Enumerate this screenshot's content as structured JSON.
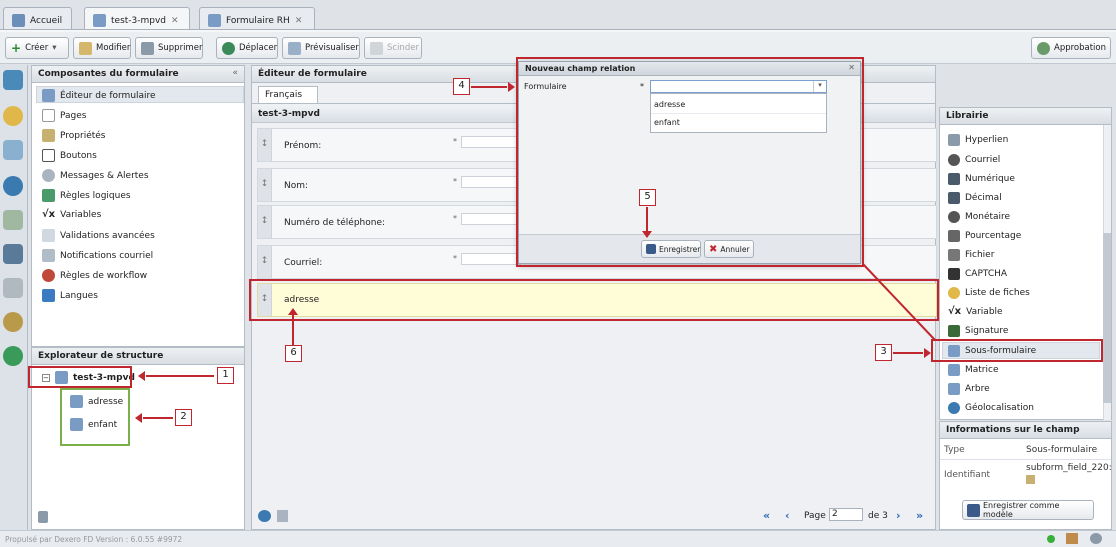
{
  "tabs": [
    "Accueil",
    "test-3-mpvd",
    "Formulaire RH"
  ],
  "toolbar": {
    "create": "Créer",
    "modify": "Modifier",
    "delete": "Supprimer",
    "move": "Déplacer",
    "preview": "Prévisualiser",
    "split": "Scinder",
    "approval": "Approbation"
  },
  "left": {
    "title": "Composantes du formulaire",
    "items": [
      "Éditeur de formulaire",
      "Pages",
      "Propriétés",
      "Boutons",
      "Messages & Alertes",
      "Règles logiques",
      "Variables",
      "Validations avancées",
      "Notifications courriel",
      "Règles de workflow",
      "Langues"
    ]
  },
  "explorer": {
    "title": "Explorateur de structure",
    "root": "test-3-mpvd",
    "children": [
      "adresse",
      "enfant"
    ]
  },
  "editor": {
    "title": "Éditeur de formulaire",
    "lang_tab": "Français",
    "form_name": "test-3-mpvd",
    "fields": [
      "Prénom:",
      "Nom:",
      "Numéro de téléphone:",
      "Courriel:"
    ],
    "required": "*",
    "new_field": "adresse"
  },
  "pager": {
    "page_label": "Page",
    "page_value": "2",
    "of_label": "de 3"
  },
  "dialog": {
    "title": "Nouveau champ relation",
    "label": "Formulaire",
    "required": "*",
    "options": [
      "adresse",
      "enfant"
    ],
    "save": "Enregistrer",
    "cancel": "Annuler"
  },
  "library": {
    "title": "Librairie",
    "items": [
      "Hyperlien",
      "Courriel",
      "Numérique",
      "Décimal",
      "Monétaire",
      "Pourcentage",
      "Fichier",
      "CAPTCHA",
      "Liste de fiches",
      "Variable",
      "Signature",
      "Sous-formulaire",
      "Matrice",
      "Arbre",
      "Géolocalisation"
    ]
  },
  "info": {
    "title": "Informations sur le champ",
    "type_label": "Type",
    "type_value": "Sous-formulaire",
    "id_label": "Identifiant",
    "id_value": "subform_field_220:",
    "save_model": "Enregistrer comme modèle"
  },
  "footer": "Propulsé par Dexero FD Version : 6.0.55 #9972",
  "callouts": [
    "1",
    "2",
    "3",
    "4",
    "5",
    "6"
  ]
}
